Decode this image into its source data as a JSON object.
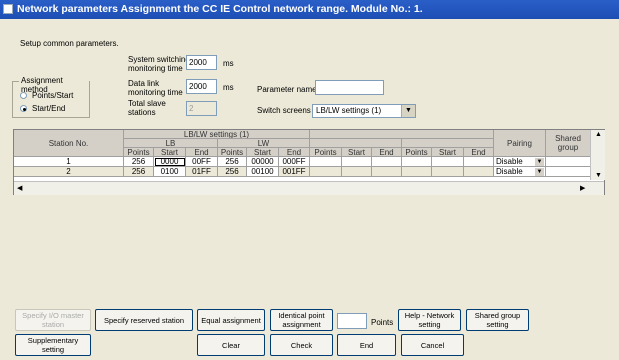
{
  "window": {
    "title": "Network parameters  Assignment the CC IE Control network range. Module No.: 1."
  },
  "setup": {
    "caption": "Setup common parameters."
  },
  "fields": {
    "sys_switch_label_1": "System switching",
    "sys_switch_label_2": "monitoring time",
    "sys_switch_value": "2000",
    "sys_switch_unit": "ms",
    "datalink_label_1": "Data link",
    "datalink_label_2": "monitoring time",
    "datalink_value": "2000",
    "datalink_unit": "ms",
    "total_label_1": "Total slave",
    "total_label_2": "stations",
    "total_value": "2",
    "param_name_label": "Parameter name",
    "param_name_value": "",
    "switch_screens_label": "Switch screens",
    "switch_screens_value": "LB/LW settings (1)"
  },
  "assignment": {
    "legend": "Assignment method",
    "option_points": "Points/Start",
    "option_startend": "Start/End"
  },
  "grid": {
    "station_header": "Station No.",
    "group_header": "LB/LW settings (1)",
    "lb_header": "LB",
    "lw_header": "LW",
    "sub_points": "Points",
    "sub_start": "Start",
    "sub_end": "End",
    "pairing_header": "Pairing",
    "shared_header_1": "Shared",
    "shared_header_2": "group",
    "rows": [
      {
        "station": "1",
        "lb_points": "256",
        "lb_start": "0000",
        "lb_end": "00FF",
        "lw_points": "256",
        "lw_start": "00000",
        "lw_end": "000FF",
        "pairing": "Disable"
      },
      {
        "station": "2",
        "lb_points": "256",
        "lb_start": "0100",
        "lb_end": "01FF",
        "lw_points": "256",
        "lw_start": "00100",
        "lw_end": "001FF",
        "pairing": "Disable"
      }
    ]
  },
  "buttons": {
    "specify_io_master": "Specify I/O master station",
    "specify_reserved": "Specify reserved station",
    "equal_assignment": "Equal assignment",
    "identical_point": "Identical point assignment",
    "points_label": "Points",
    "points_value": "",
    "help_network": "Help - Network setting",
    "shared_group": "Shared group setting",
    "supplementary": "Supplementary setting",
    "clear": "Clear",
    "check": "Check",
    "end": "End",
    "cancel": "Cancel"
  }
}
